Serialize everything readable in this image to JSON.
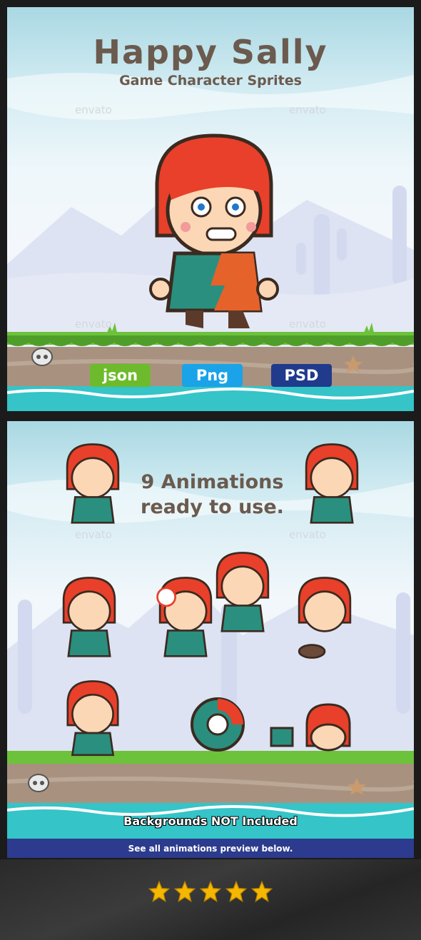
{
  "panel1": {
    "title": "Happy Sally",
    "subtitle": "Game Character Sprites",
    "watermark": "envato",
    "badges": [
      {
        "label": "json",
        "color": "#6dbb2c"
      },
      {
        "label": "Png",
        "color": "#1aa3e8"
      },
      {
        "label": "PSD",
        "color": "#203a8c"
      }
    ]
  },
  "panel2": {
    "animations_line1": "9 Animations",
    "animations_line2": "ready to use.",
    "backgrounds_note": "Backgrounds NOT Included",
    "preview_note": "See all animations preview below.",
    "watermark": "envato"
  },
  "footer": {
    "rating_stars": 5,
    "star_color": "#f5b700"
  },
  "colors": {
    "hair": "#e8402a",
    "shirt": "#2a8f7e",
    "grass": "#6cc23a",
    "water": "#35c4c8",
    "text": "#6b5a4e"
  }
}
